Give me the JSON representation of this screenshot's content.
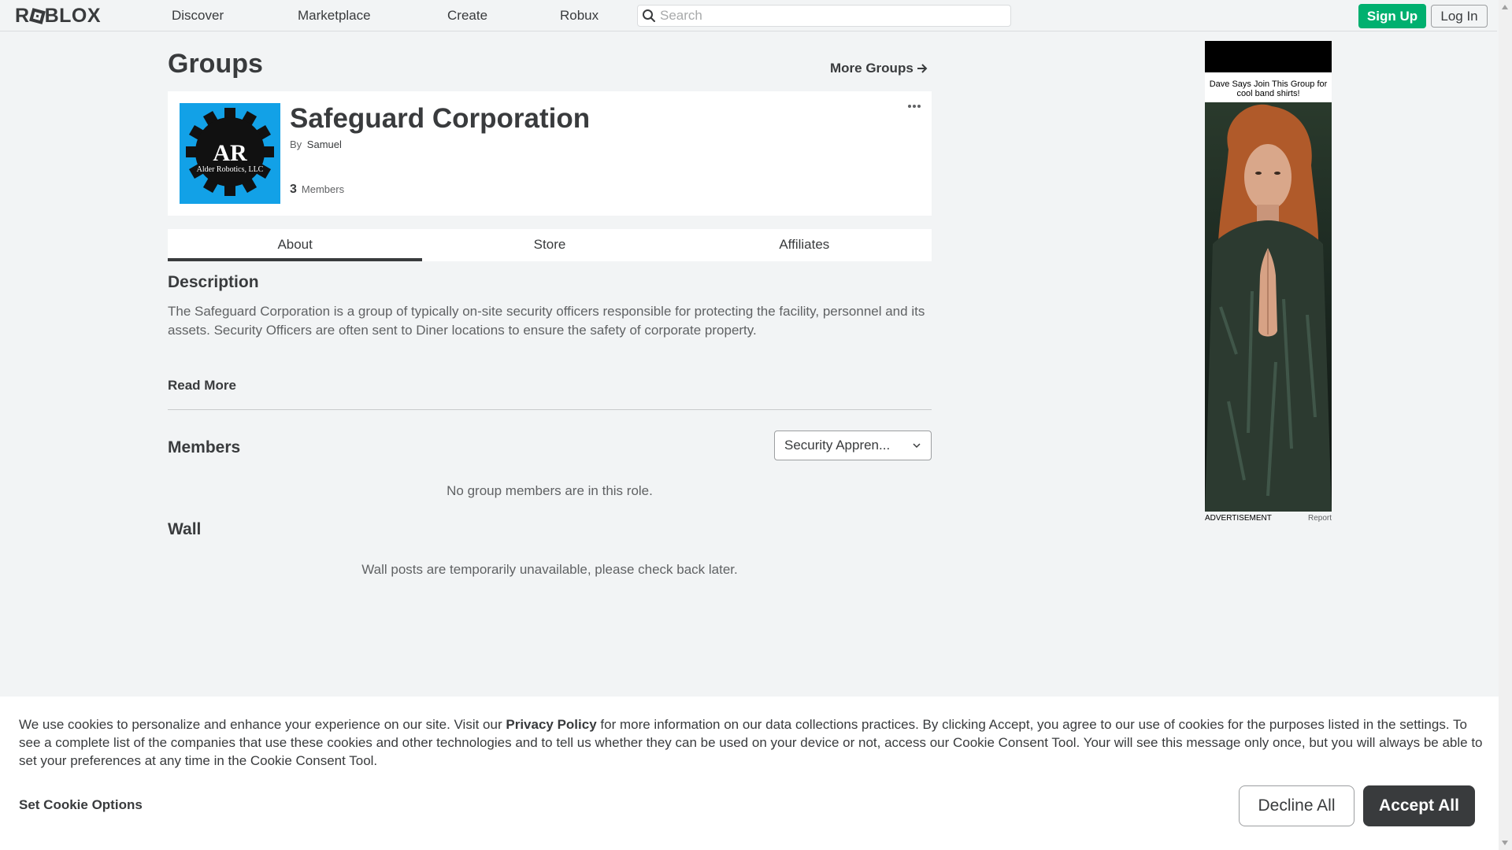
{
  "nav": {
    "logo_text": "ROBLOX",
    "links": [
      "Discover",
      "Marketplace",
      "Create",
      "Robux"
    ],
    "search_placeholder": "Search",
    "signup_label": "Sign Up",
    "login_label": "Log In"
  },
  "page": {
    "heading": "Groups",
    "more_groups_label": "More Groups"
  },
  "group": {
    "name": "Safeguard Corporation",
    "by_label": "By",
    "owner": "Samuel",
    "member_count": "3",
    "members_label": "Members",
    "emblem_initials": "AR",
    "emblem_company": "Alder Robotics, LLC",
    "emblem_bg": "#12a1e7"
  },
  "tabs": [
    {
      "label": "About",
      "active": true
    },
    {
      "label": "Store",
      "active": false
    },
    {
      "label": "Affiliates",
      "active": false
    }
  ],
  "about": {
    "description_title": "Description",
    "description": "The Safeguard Corporation is a group of typically on-site security officers responsible for protecting the facility, personnel and its assets. Security Officers are often sent to Diner locations to ensure the safety of corporate property.",
    "read_more": "Read More",
    "members_title": "Members",
    "role_selected": "Security Appren...",
    "no_members_message": "No group members are in this role.",
    "wall_title": "Wall",
    "wall_message": "Wall posts are temporarily unavailable, please check back later."
  },
  "ad": {
    "caption": "Dave Says Join This Group for cool band shirts!",
    "label": "ADVERTISEMENT",
    "report": "Report"
  },
  "cookie_banner": {
    "text_before": "We use cookies to personalize and enhance your experience on our site. Visit our ",
    "policy_link": "Privacy Policy",
    "text_after": " for more information on our data collections practices. By clicking Accept, you agree to our use of cookies for the purposes listed in the settings. To see a complete list of the companies that use these cookies and other technologies and to tell us whether they can be used on your device or not, access our Cookie Consent Tool. Your will see this message only once, but you will always be able to set your preferences at any time in the Cookie Consent Tool.",
    "set_options": "Set Cookie Options",
    "decline": "Decline All",
    "accept": "Accept All"
  },
  "colors": {
    "signup_green": "#00b06f",
    "page_bg": "#f2f4f5",
    "text_dark": "#393b3d"
  }
}
